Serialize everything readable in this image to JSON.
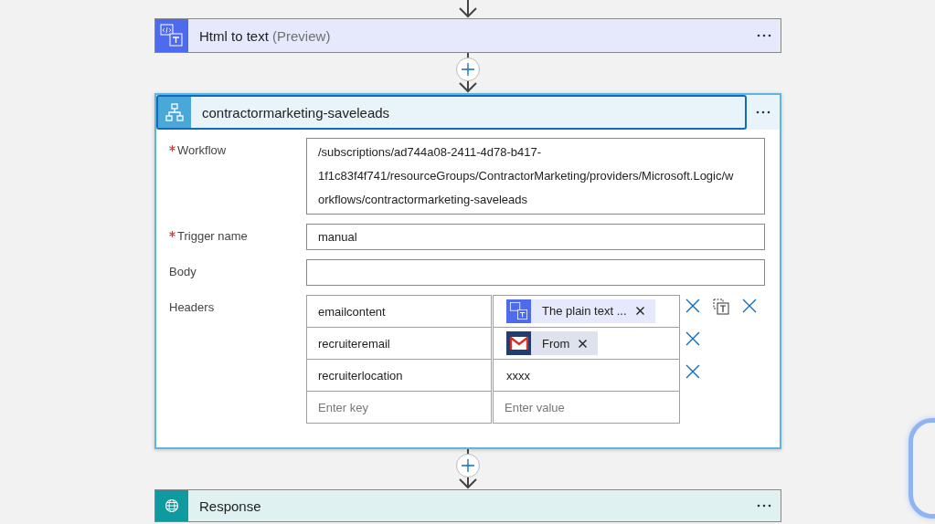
{
  "html_step": {
    "kind": "html",
    "title": "Html to text",
    "note": "(Preview)"
  },
  "workflow_step": {
    "kind": "workflow",
    "title": "contractormarketing-saveleads",
    "selected": true,
    "fields": [
      {
        "label": "Workflow",
        "required": true,
        "value_lines": [
          "/subscriptions/ad744a08-2411-4d78-b417-",
          "1f1c83f4f741/resourceGroups/ContractorMarketing/providers/Microsoft.Logic/w",
          "orkflows/contractormarketing-saveleads"
        ]
      },
      {
        "label": "Trigger name",
        "required": true,
        "value_lines": [
          "manual"
        ]
      },
      {
        "label": "Body",
        "required": false
      }
    ],
    "headers": {
      "label": "Headers",
      "rows": [
        {
          "key": "emailcontent",
          "value": {
            "kind": "html_token",
            "text": "The plain text ..."
          }
        },
        {
          "key": "recruiteremail",
          "value": {
            "kind": "gmail_token",
            "text": "From"
          }
        },
        {
          "key": "recruiterlocation",
          "value": {
            "kind": "text",
            "text": "xxxx"
          }
        }
      ],
      "key_placeholder": "Enter key",
      "value_placeholder": "Enter value"
    }
  },
  "response_step": {
    "kind": "response",
    "title": "Response"
  }
}
